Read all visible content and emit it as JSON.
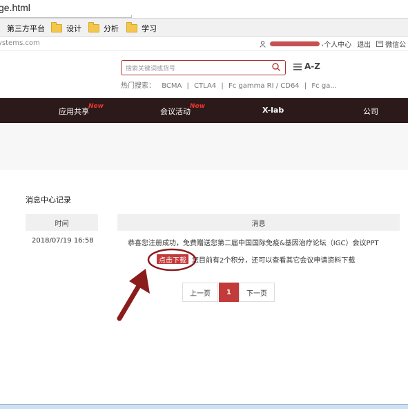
{
  "browser": {
    "url_fragment": "ge.html",
    "bookmarks": [
      {
        "label": "第三方平台",
        "icon": "folder-icon"
      },
      {
        "label": "设计",
        "icon": "folder-icon"
      },
      {
        "label": "分析",
        "icon": "folder-icon"
      },
      {
        "label": "学习",
        "icon": "folder-icon"
      }
    ]
  },
  "site": {
    "domain_fragment": "ystems.com",
    "user": {
      "separator": ", ",
      "links": [
        "个人中心",
        "退出",
        "微信公"
      ]
    },
    "search": {
      "placeholder": "搜索关键词或货号",
      "az_label": "A-Z"
    },
    "hot_search": {
      "label": "热门搜索：",
      "terms": [
        "BCMA",
        "CTLA4",
        "Fc gamma RI / CD64",
        "Fc ga..."
      ]
    },
    "nav": [
      {
        "label": "应用共享",
        "badge": "New"
      },
      {
        "label": "会议活动",
        "badge": "New"
      },
      {
        "label": "X-lab",
        "badge": ""
      },
      {
        "label": "公司",
        "badge": ""
      }
    ]
  },
  "message_center": {
    "title": "消息中心记录",
    "columns": [
      "时间",
      "消息"
    ],
    "rows": [
      {
        "time": "2018/07/19 16:58",
        "message": "恭喜您注册成功，免费赠送您第二届中国国际免疫&基因治疗论坛（IGC）会议PPT",
        "download_label": "点击下载",
        "tail": "您目前有2个积分，还可以查看其它会议申请资料下载"
      }
    ],
    "pagination": {
      "prev": "上一页",
      "current": "1",
      "next": "下一页"
    }
  },
  "colors": {
    "accent": "#c23a3a",
    "nav_bg": "#2b1a19",
    "annotation": "#8b1c1c"
  }
}
